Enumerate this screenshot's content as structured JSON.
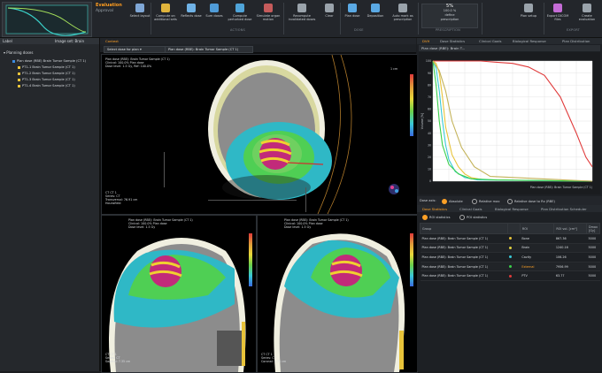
{
  "app": {
    "title": "Evaluation",
    "subtitle": "Approval"
  },
  "ribbon": {
    "buttons": [
      {
        "label": "Select layout",
        "color": "#7fa7d6"
      },
      {
        "label": "Compute on additional sets",
        "color": "#e0b43c"
      },
      {
        "label": "Reflects dose",
        "color": "#6fb2e6"
      },
      {
        "label": "Sum doses",
        "color": "#4f9bd7"
      },
      {
        "label": "Compute perturbed dose",
        "color": "#4fa4d9"
      },
      {
        "label": "Simulate organ motion",
        "color": "#c55b5b"
      },
      {
        "label": "Recompute invalidated doses",
        "color": "#9aa3ab"
      },
      {
        "label": "Clear",
        "color": "#9aa3ab"
      },
      {
        "label": "Plan dose",
        "color": "#5aa9e4"
      },
      {
        "label": "Deposition",
        "color": "#5aa9e4"
      },
      {
        "label": "Auto mark as prescription",
        "color": "#9aa3ab"
      },
      {
        "label": "Plan setup",
        "color": "#9aa3ab"
      },
      {
        "label": "Export DICOM files",
        "color": "#c46cd6"
      },
      {
        "label": "Create evaluation",
        "color": "#9aa3ab"
      }
    ],
    "groups": {
      "actions": "ACTIONS",
      "dose": "DOSE",
      "prescription": "PRESCRIPTION",
      "export": "EXPORT"
    },
    "prescription_box": {
      "value": "5%",
      "line2": "100.0 %",
      "line3": "define",
      "line4": "prescription"
    }
  },
  "left_panel": {
    "header_left": "Label",
    "header_right": "Image set: Brain",
    "section_title": "Planning doses",
    "items": [
      {
        "label": "Plan dose (RBE) Brain Tumor Sample",
        "tag": "CT 1",
        "color": "#3b8be0"
      },
      {
        "label": "PT1-1 Brain Tumor Sample",
        "tag": "CT 1",
        "color": "#e8c33a"
      },
      {
        "label": "PT1-2 Brain Tumor Sample",
        "tag": "CT 1",
        "color": "#e8c33a"
      },
      {
        "label": "PT1-3 Brain Tumor Sample",
        "tag": "CT 1",
        "color": "#e8c33a"
      },
      {
        "label": "PT1-4 Brain Tumor Sample",
        "tag": "CT 1",
        "color": "#e8c33a"
      }
    ]
  },
  "viewer": {
    "context_tab": "Context",
    "dose_select": "Select dose for plan",
    "dose_title": "Plan dose (RBE): Brain Tumor Sample (CT 1)",
    "axial_overlay": [
      "Plan dose (RBE): Brain Tumor Sample (CT 1)",
      "Clinical: 100.0% Plan dose",
      "Dose level: 1.5 Gy, Ref: 100.0%"
    ],
    "axial_zoom": "1 cm",
    "axial_info": [
      "CT CT 1",
      "Series: CT",
      "Transversal: 76.91 cm",
      "Hounsfield"
    ],
    "sagittal_overlay": [
      "Plan dose (RBE): Brain Tumor Sample (CT 1)",
      "Clinical: 100.0% Plan dose",
      "Dose level: 1.5 Gy"
    ],
    "sagittal_info": [
      "CT CT 1",
      "Series: CT",
      "Sagittal: 7.35 cm"
    ],
    "coronal_overlay": [
      "Plan dose (RBE): Brain Tumor Sample (CT 1)",
      "Clinical: 100.0% Plan dose",
      "Dose level: 1.5 Gy"
    ],
    "coronal_info": [
      "CT CT 1",
      "Series: CT",
      "Coronal: 1.75 cm"
    ]
  },
  "right_panel": {
    "tabs": [
      "DVH",
      "Dose Statistics",
      "Clinical Goals",
      "Biological Response",
      "Plan Distribution"
    ],
    "dvh_title": "Plan dose (RBE): Brain T...",
    "dvh_footer_label": "Dose axis:",
    "dvh_options": [
      "Absolute",
      "Relative max",
      "Relative dose to Rx (RBE)"
    ],
    "stats_tabs": [
      "Dose Statistics",
      "Clinical Goals",
      "Biological Response",
      "Plan Distribution Scheduler"
    ],
    "stats_options": [
      "ROI statistics",
      "POI statistics"
    ],
    "table": {
      "columns": [
        "Group",
        "",
        "ROI",
        "ROI vol. [cm³]",
        "Dmax [Gy]"
      ],
      "rows": [
        {
          "group": "Plan dose (RBE): Brain Tumor Sample (CT 1)",
          "color": "#e8c33a",
          "roi": "Bone",
          "vol": "867.36",
          "dmax": "5000"
        },
        {
          "group": "Plan dose (RBE): Brain Tumor Sample (CT 1)",
          "color": "#e0d040",
          "roi": "Brain",
          "vol": "1240.16",
          "dmax": "5000"
        },
        {
          "group": "Plan dose (RBE): Brain Tumor Sample (CT 1)",
          "color": "#39c9d6",
          "roi": "Cavity",
          "vol": "106.26",
          "dmax": "5000"
        },
        {
          "group": "Plan dose (RBE): Brain Tumor Sample (CT 1)",
          "color": "#3ad04a",
          "roi": "External",
          "vol": "7956.99",
          "dmax": "5000"
        },
        {
          "group": "Plan dose (RBE): Brain Tumor Sample (CT 1)",
          "color": "#e03a3a",
          "roi": "PTV",
          "vol": "63.77",
          "dmax": "5000"
        }
      ]
    }
  },
  "chart_data": {
    "type": "line",
    "title": "",
    "xlabel": "Plan dose (RBE): Brain Tumor Sample (CT 1)",
    "ylabel": "Volume [%]",
    "ylim": [
      0,
      100
    ],
    "xlim": [
      0,
      5000
    ],
    "legend": "none",
    "grid": true,
    "series": [
      {
        "color": "#e03a3a",
        "x": [
          0,
          1500,
          2000,
          2500,
          3000,
          3500,
          4000,
          4500,
          4800,
          5000
        ],
        "y": [
          100,
          100,
          99,
          98,
          95,
          88,
          70,
          40,
          20,
          12
        ]
      },
      {
        "color": "#e8c33a",
        "x": [
          0,
          100,
          200,
          300,
          400,
          600,
          800,
          1000,
          1200,
          1600,
          5000
        ],
        "y": [
          100,
          98,
          90,
          70,
          45,
          22,
          12,
          6,
          3,
          1,
          0
        ]
      },
      {
        "color": "#39c9d6",
        "x": [
          0,
          100,
          200,
          300,
          400,
          500,
          700,
          1000,
          1400,
          5000
        ],
        "y": [
          100,
          94,
          75,
          50,
          30,
          18,
          8,
          3,
          1,
          0
        ]
      },
      {
        "color": "#3ad04a",
        "x": [
          0,
          100,
          200,
          300,
          500,
          800,
          1200,
          2000,
          5000
        ],
        "y": [
          100,
          80,
          50,
          30,
          14,
          6,
          2,
          1,
          0
        ]
      },
      {
        "color": "#c4b35a",
        "x": [
          0,
          200,
          400,
          600,
          900,
          1300,
          1800,
          5000
        ],
        "y": [
          100,
          92,
          75,
          50,
          28,
          12,
          4,
          0
        ]
      }
    ]
  }
}
